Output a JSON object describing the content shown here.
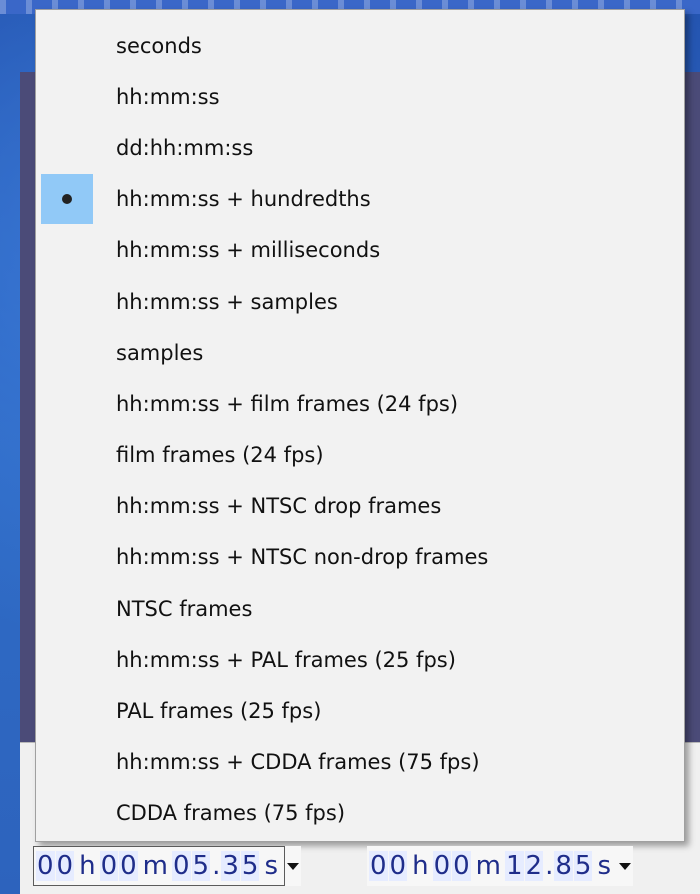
{
  "menu": {
    "items": [
      {
        "label": "seconds",
        "selected": false
      },
      {
        "label": "hh:mm:ss",
        "selected": false
      },
      {
        "label": "dd:hh:mm:ss",
        "selected": false
      },
      {
        "label": "hh:mm:ss + hundredths",
        "selected": true
      },
      {
        "label": "hh:mm:ss + milliseconds",
        "selected": false
      },
      {
        "label": "hh:mm:ss + samples",
        "selected": false
      },
      {
        "label": "samples",
        "selected": false
      },
      {
        "label": "hh:mm:ss + film frames (24 fps)",
        "selected": false
      },
      {
        "label": "film frames (24 fps)",
        "selected": false
      },
      {
        "label": "hh:mm:ss + NTSC drop frames",
        "selected": false
      },
      {
        "label": "hh:mm:ss + NTSC non-drop frames",
        "selected": false
      },
      {
        "label": "NTSC frames",
        "selected": false
      },
      {
        "label": "hh:mm:ss + PAL frames (25 fps)",
        "selected": false
      },
      {
        "label": "PAL frames (25 fps)",
        "selected": false
      },
      {
        "label": "hh:mm:ss + CDDA frames (75 fps)",
        "selected": false
      },
      {
        "label": "CDDA frames (75 fps)",
        "selected": false
      }
    ],
    "selection_highlight": "#91c9f7"
  },
  "time_controls": [
    {
      "name": "selection-start",
      "digits": {
        "h1": "0",
        "h2": "0",
        "m1": "0",
        "m2": "0",
        "s1": "0",
        "s2": "5",
        "dot": ".",
        "f1": "3",
        "f2": "5"
      },
      "units": {
        "h": "h",
        "m": "m",
        "s": "s"
      },
      "focused": true
    },
    {
      "name": "selection-end",
      "digits": {
        "h1": "0",
        "h2": "0",
        "m1": "0",
        "m2": "0",
        "s1": "1",
        "s2": "2",
        "dot": ".",
        "f1": "8",
        "f2": "5"
      },
      "units": {
        "h": "h",
        "m": "m",
        "s": "s"
      },
      "focused": false
    }
  ],
  "colors": {
    "menu_background": "#f2f2f2",
    "digit_text": "#1f2d8a"
  }
}
